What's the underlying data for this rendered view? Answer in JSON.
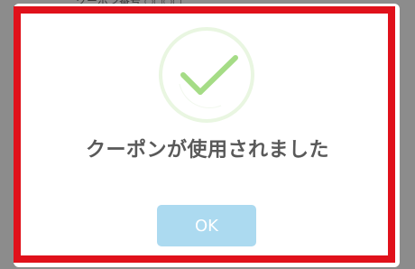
{
  "backdrop": {
    "partial_text": "クーポン番号 ○○○○"
  },
  "dialog": {
    "icon": "success-check-icon",
    "message": "クーポンが使用されました",
    "ok_label": "OK"
  },
  "colors": {
    "backdrop": "#8c8c8c",
    "highlight": "#e0111b",
    "check": "#a5dc86",
    "check_ring": "#e9f6e1",
    "button": "#acdaf0",
    "message": "#595959"
  }
}
